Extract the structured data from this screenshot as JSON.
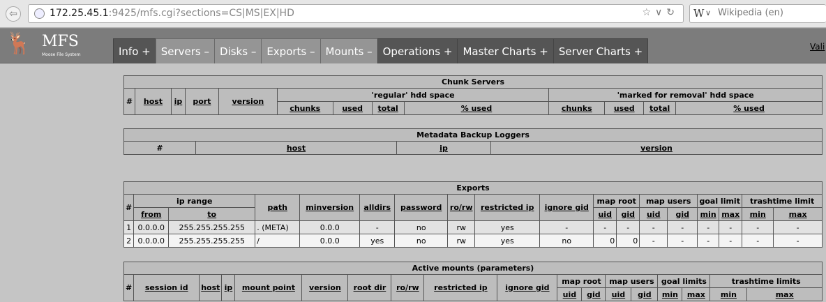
{
  "browser": {
    "url_host": "172.25.45.1",
    "url_rest": ":9425/mfs.cgi?sections=CS|MS|EX|HD",
    "search_engine_glyph": "W",
    "search_placeholder": "Wikipedia (en)"
  },
  "header": {
    "logo_text": "MFS",
    "logo_subtitle": "Moose File System",
    "valid_link": "Vali"
  },
  "menu": [
    {
      "label": "Info +",
      "active": false
    },
    {
      "label": "Servers –",
      "active": true
    },
    {
      "label": "Disks –",
      "active": true
    },
    {
      "label": "Exports –",
      "active": true
    },
    {
      "label": "Mounts –",
      "active": true
    },
    {
      "label": "Operations +",
      "active": false
    },
    {
      "label": "Master Charts +",
      "active": false
    },
    {
      "label": "Server Charts +",
      "active": false
    }
  ],
  "chunk_servers": {
    "title": "Chunk Servers",
    "cols": {
      "num": "#",
      "host": "host",
      "ip": "ip",
      "port": "port",
      "version": "version"
    },
    "regular": "'regular' hdd space",
    "removal": "'marked for removal' hdd space",
    "sub": {
      "chunks": "chunks",
      "used": "used",
      "total": "total",
      "pct": "% used"
    }
  },
  "metaloggers": {
    "title": "Metadata Backup Loggers",
    "cols": {
      "num": "#",
      "host": "host",
      "ip": "ip",
      "version": "version"
    }
  },
  "exports": {
    "title": "Exports",
    "cols": {
      "num": "#",
      "ip_range": "ip range",
      "from": "from",
      "to": "to",
      "path": "path",
      "minversion": "minversion",
      "alldirs": "alldirs",
      "password": "password",
      "rorw": "ro/rw",
      "restricted_ip": "restricted ip",
      "ignore_gid": "ignore gid",
      "map_root": "map root",
      "map_users": "map users",
      "goal_limit": "goal limit",
      "trashtime_limit": "trashtime limit",
      "uid": "uid",
      "gid": "gid",
      "min": "min",
      "max": "max"
    },
    "rows": [
      {
        "num": "1",
        "from": "0.0.0.0",
        "to": "255.255.255.255",
        "path": ". (META)",
        "minversion": "0.0.0",
        "alldirs": "-",
        "password": "no",
        "rorw": "rw",
        "restricted_ip": "yes",
        "ignore_gid": "-",
        "root_uid": "-",
        "root_gid": "-",
        "users_uid": "-",
        "users_gid": "-",
        "goal_min": "-",
        "goal_max": "-",
        "trash_min": "-",
        "trash_max": "-"
      },
      {
        "num": "2",
        "from": "0.0.0.0",
        "to": "255.255.255.255",
        "path": "/",
        "minversion": "0.0.0",
        "alldirs": "yes",
        "password": "no",
        "rorw": "rw",
        "restricted_ip": "yes",
        "ignore_gid": "no",
        "root_uid": "0",
        "root_gid": "0",
        "users_uid": "-",
        "users_gid": "-",
        "goal_min": "-",
        "goal_max": "-",
        "trash_min": "-",
        "trash_max": "-"
      }
    ]
  },
  "mounts": {
    "title": "Active mounts (parameters)",
    "cols": {
      "num": "#",
      "session_id": "session id",
      "host": "host",
      "ip": "ip",
      "mount_point": "mount point",
      "version": "version",
      "root_dir": "root dir",
      "rorw": "ro/rw",
      "restricted_ip": "restricted ip",
      "ignore_gid": "ignore gid",
      "map_root": "map root",
      "map_users": "map users",
      "goal_limits": "goal limits",
      "trashtime_limits": "trashtime limits",
      "uid": "uid",
      "gid": "gid",
      "min": "min",
      "max": "max"
    }
  }
}
